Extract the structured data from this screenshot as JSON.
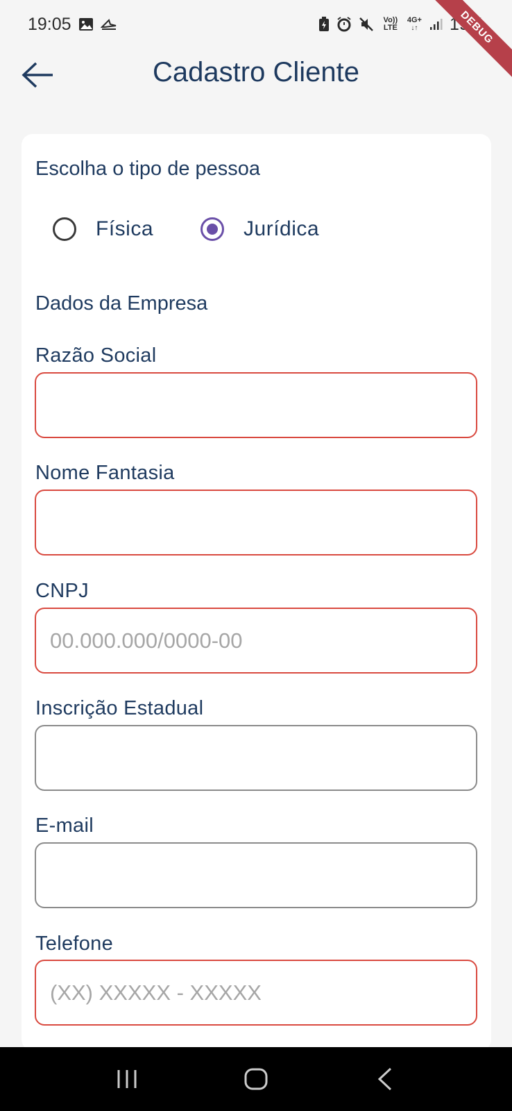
{
  "status_bar": {
    "time": "19:05",
    "battery_percent": "19%",
    "network": "4G+",
    "volte": "Vo)) LTE",
    "icons": [
      "gallery-icon",
      "cast-icon",
      "battery-saver-icon",
      "alarm-icon",
      "mute-icon",
      "volte-icon",
      "network-4g-icon",
      "signal-icon"
    ]
  },
  "debug_banner": "DEBUG",
  "header": {
    "title": "Cadastro Cliente",
    "back_icon": "arrow-back-icon"
  },
  "form": {
    "person_type_title": "Escolha o tipo de pessoa",
    "person_type_options": [
      {
        "label": "Física",
        "selected": false
      },
      {
        "label": "Jurídica",
        "selected": true
      }
    ],
    "company_section_title": "Dados da Empresa",
    "fields": {
      "razao_social": {
        "label": "Razão Social",
        "value": "",
        "placeholder": ""
      },
      "nome_fantasia": {
        "label": "Nome Fantasia",
        "value": "",
        "placeholder": ""
      },
      "cnpj": {
        "label": "CNPJ",
        "value": "",
        "placeholder": "00.000.000/0000-00"
      },
      "inscricao_estadual": {
        "label": "Inscrição Estadual",
        "value": "",
        "placeholder": ""
      },
      "email": {
        "label": "E-mail",
        "value": "",
        "placeholder": ""
      },
      "telefone": {
        "label": "Telefone",
        "value": "",
        "placeholder": "(XX) XXXXX - XXXXX"
      }
    }
  },
  "colors": {
    "primary_text": "#1e3a5f",
    "error_border": "#d9493f",
    "neutral_border": "#8a8a8a",
    "radio_selected": "#6a4fa8",
    "background": "#f5f5f5",
    "card": "#ffffff"
  },
  "nav_bar": {
    "buttons": [
      "recent-apps-icon",
      "home-icon",
      "back-icon"
    ]
  }
}
